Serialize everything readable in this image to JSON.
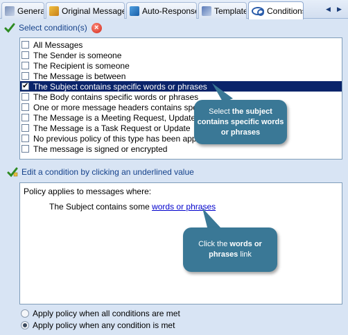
{
  "tabs": [
    {
      "label": "General",
      "icon": "general-icon"
    },
    {
      "label": "Original Message",
      "icon": "envelope-icon"
    },
    {
      "label": "Auto-Response",
      "icon": "auto-response-icon"
    },
    {
      "label": "Template",
      "icon": "template-icon"
    },
    {
      "label": "Conditions",
      "icon": "conditions-icon",
      "active": true
    }
  ],
  "tab_scroll": {
    "left": "◀",
    "right": "▶"
  },
  "select_section": {
    "label": "Select condition(s)",
    "clear": "×"
  },
  "conditions": [
    {
      "label": "All Messages",
      "checked": false
    },
    {
      "label": "The Sender is someone",
      "checked": false
    },
    {
      "label": "The Recipient is someone",
      "checked": false
    },
    {
      "label": "The Message is between",
      "checked": false
    },
    {
      "label": "The Subject contains specific words or phrases",
      "checked": true,
      "selected": true
    },
    {
      "label": "The Body contains specific words or phrases",
      "checked": false
    },
    {
      "label": "One or more message headers contains specific words or phrases",
      "checked": false
    },
    {
      "label": "The Message is a Meeting Request, Update or Response",
      "checked": false
    },
    {
      "label": "The Message is a Task Request or Update",
      "checked": false
    },
    {
      "label": "No previous policy of this type has been applied",
      "checked": false
    },
    {
      "label": "The message is signed or encrypted",
      "checked": false
    }
  ],
  "edit_section": {
    "label": "Edit a condition by clicking an underlined value"
  },
  "policy": {
    "title": "Policy applies to messages where:",
    "line_prefix": "The Subject contains some ",
    "link": "words or phrases"
  },
  "radios": [
    {
      "label": "Apply policy when all conditions are met",
      "selected": false
    },
    {
      "label": "Apply policy when any condition is met",
      "selected": true
    }
  ],
  "callout_1": {
    "plain": "Select ",
    "bold": "the subject contains specific words or phrases"
  },
  "callout_2": {
    "plain": "Click the ",
    "bold": "words or phrases",
    "tail": " link"
  },
  "colors": {
    "selection": "#0a246a",
    "callout": "#3a7896",
    "link": "#0000cc",
    "section_text": "#15428b"
  }
}
